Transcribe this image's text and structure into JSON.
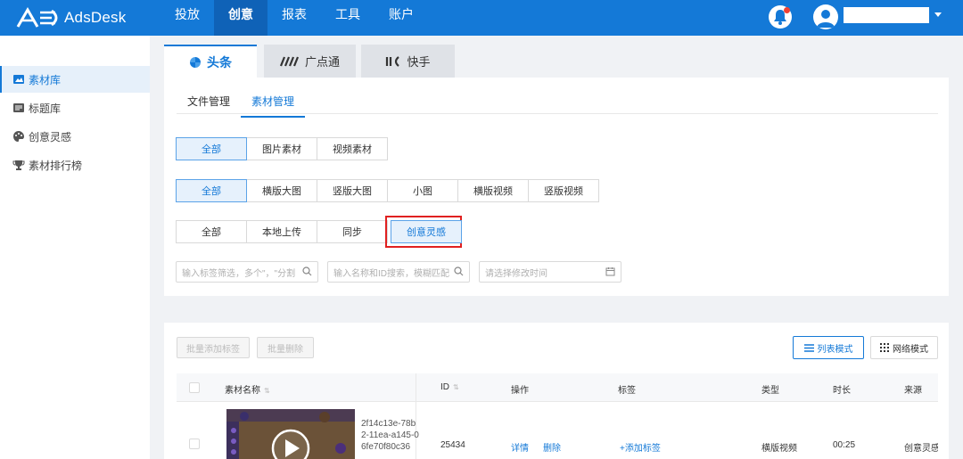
{
  "app": {
    "name": "AdsDesk"
  },
  "topnav": {
    "items": [
      "投放",
      "创意",
      "报表",
      "工具",
      "账户"
    ],
    "active_index": 1
  },
  "sidebar": {
    "items": [
      "素材库",
      "标题库",
      "创意灵感",
      "素材排行榜"
    ],
    "active_index": 0
  },
  "channel_tabs": [
    {
      "label": "头条",
      "icon": "toutiao-icon"
    },
    {
      "label": "广点通",
      "icon": "guangdiantong-icon"
    },
    {
      "label": "快手",
      "icon": "kuaishou-icon"
    }
  ],
  "sub_tabs": {
    "items": [
      "文件管理",
      "素材管理"
    ],
    "active_index": 1
  },
  "filters": {
    "media_type": {
      "options": [
        "全部",
        "图片素材",
        "视频素材"
      ],
      "selected": 0
    },
    "format": {
      "options": [
        "全部",
        "横版大图",
        "竖版大图",
        "小图",
        "横版视频",
        "竖版视频"
      ],
      "selected": 0
    },
    "source": {
      "options": [
        "全部",
        "本地上传",
        "同步",
        "创意灵感"
      ],
      "selected": 3
    },
    "tag_placeholder": "输入标签筛选，多个\"，\"分割",
    "name_placeholder": "输入名称和ID搜索，模糊匹配",
    "date_placeholder": "请选择修改时间"
  },
  "toolbar": {
    "batch_add_tag": "批量添加标签",
    "batch_delete": "批量删除",
    "list_mode": "列表模式",
    "grid_mode": "网络模式"
  },
  "table": {
    "columns": [
      "素材名称",
      "ID",
      "操作",
      "标签",
      "类型",
      "时长",
      "来源"
    ],
    "rows": [
      {
        "name": "2f14c13e-78b2-11ea-a145-06fe70f80c36",
        "id": "25434",
        "actions": [
          "详情",
          "删除"
        ],
        "tag_action": "+添加标签",
        "type": "横版视频",
        "duration": "00:25",
        "source": "创意灵感"
      }
    ]
  },
  "colors": {
    "primary": "#1479d7",
    "highlight": "#e02020",
    "notification": "#f04134"
  }
}
